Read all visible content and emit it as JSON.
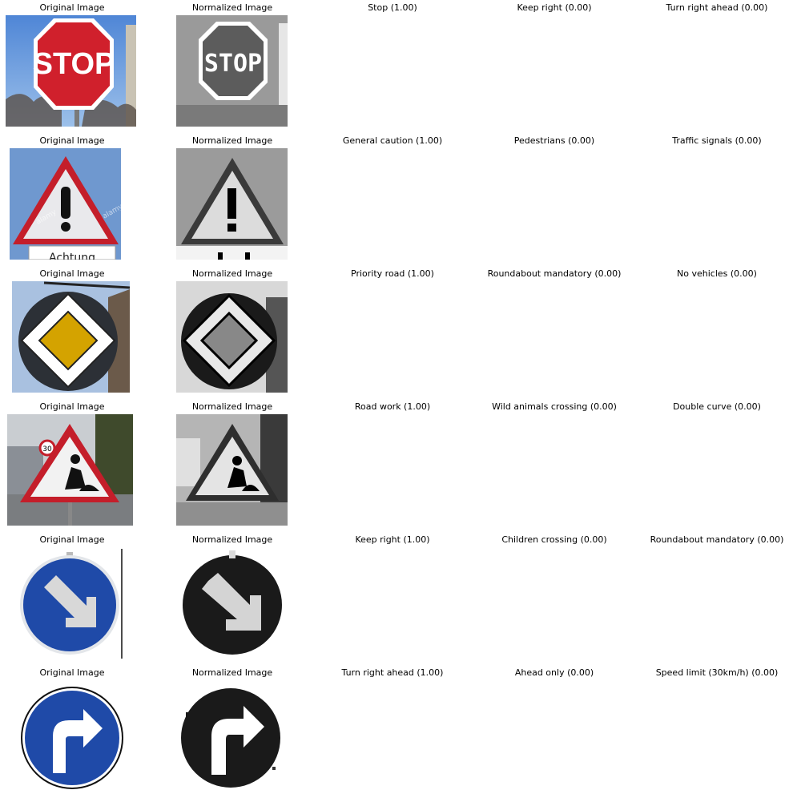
{
  "col_titles": {
    "original": "Original Image",
    "normalized": "Normalized Image"
  },
  "rows": [
    {
      "sign": "stop",
      "predictions": [
        "Stop (1.00)",
        "Keep right (0.00)",
        "Turn right ahead (0.00)"
      ],
      "sign_text": "STOP"
    },
    {
      "sign": "general-caution",
      "predictions": [
        "General caution (1.00)",
        "Pedestrians (0.00)",
        "Traffic signals (0.00)"
      ],
      "sign_text": "Achtung",
      "watermark": "alamy"
    },
    {
      "sign": "priority-road",
      "predictions": [
        "Priority road (1.00)",
        "Roundabout mandatory (0.00)",
        "No vehicles (0.00)"
      ]
    },
    {
      "sign": "road-work",
      "predictions": [
        "Road work (1.00)",
        "Wild animals crossing (0.00)",
        "Double curve (0.00)"
      ],
      "sign_text": "30"
    },
    {
      "sign": "keep-right",
      "predictions": [
        "Keep right (1.00)",
        "Children crossing (0.00)",
        "Roundabout mandatory (0.00)"
      ]
    },
    {
      "sign": "turn-right-ahead",
      "predictions": [
        "Turn right ahead (1.00)",
        "Ahead only (0.00)",
        "Speed limit (30km/h) (0.00)"
      ]
    }
  ],
  "colors": {
    "red": "#c8202b",
    "blue": "#1f4aa8",
    "yellow": "#d4a300",
    "sky": "#6f9ad2"
  }
}
